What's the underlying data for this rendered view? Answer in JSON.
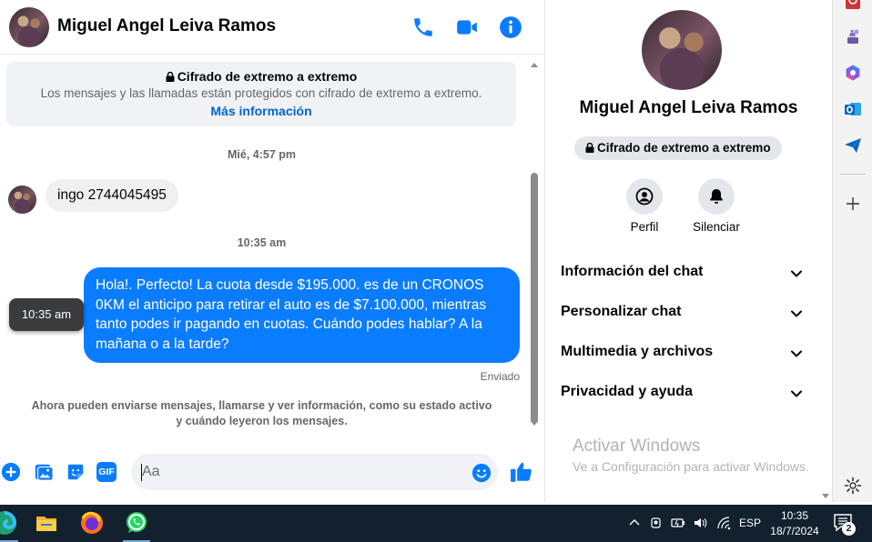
{
  "header": {
    "contact_name": "Miguel Angel Leiva Ramos"
  },
  "encryption_notice": {
    "title": "Cifrado de extremo a extremo",
    "description": "Los mensajes y las llamadas están protegidos con cifrado de extremo a extremo.",
    "link": "Más información"
  },
  "messages": {
    "timestamp_1": "Mié, 4:57 pm",
    "incoming_text": "ingo 2744045495",
    "timestamp_2": "10:35 am",
    "outgoing_text": "Hola!. Perfecto! La cuota desde $195.000. es de un CRONOS 0KM el anticipo para retirar el auto es de $7.100.000, mientras tanto podes ir pagando en cuotas. Cuándo podes hablar? A la mañana o a la tarde?",
    "hover_time": "10:35 am",
    "status": "Enviado",
    "info_notice": "Ahora pueden enviarse mensajes, llamarse y ver información, como su estado activo y cuándo leyeron los mensajes."
  },
  "composer": {
    "placeholder": "Aa",
    "gif_label": "GIF"
  },
  "details": {
    "name": "Miguel Angel Leiva Ramos",
    "encryption_chip": "Cifrado de extremo a extremo",
    "actions": [
      {
        "label": "Perfil",
        "icon": "profile-icon"
      },
      {
        "label": "Silenciar",
        "icon": "bell-icon"
      }
    ],
    "sections": [
      {
        "label": "Información del chat"
      },
      {
        "label": "Personalizar chat"
      },
      {
        "label": "Multimedia y archivos"
      },
      {
        "label": "Privacidad y ayuda"
      }
    ],
    "watermark_title": "Activar Windows",
    "watermark_subtitle": "Ve a Configuración para activar Windows."
  },
  "taskbar": {
    "language": "ESP",
    "time": "10:35",
    "date": "18/7/2024",
    "notification_count": "2"
  },
  "colors": {
    "messenger_blue": "#0a7cff",
    "link_blue": "#0064d1",
    "taskbar": "#13202e"
  }
}
